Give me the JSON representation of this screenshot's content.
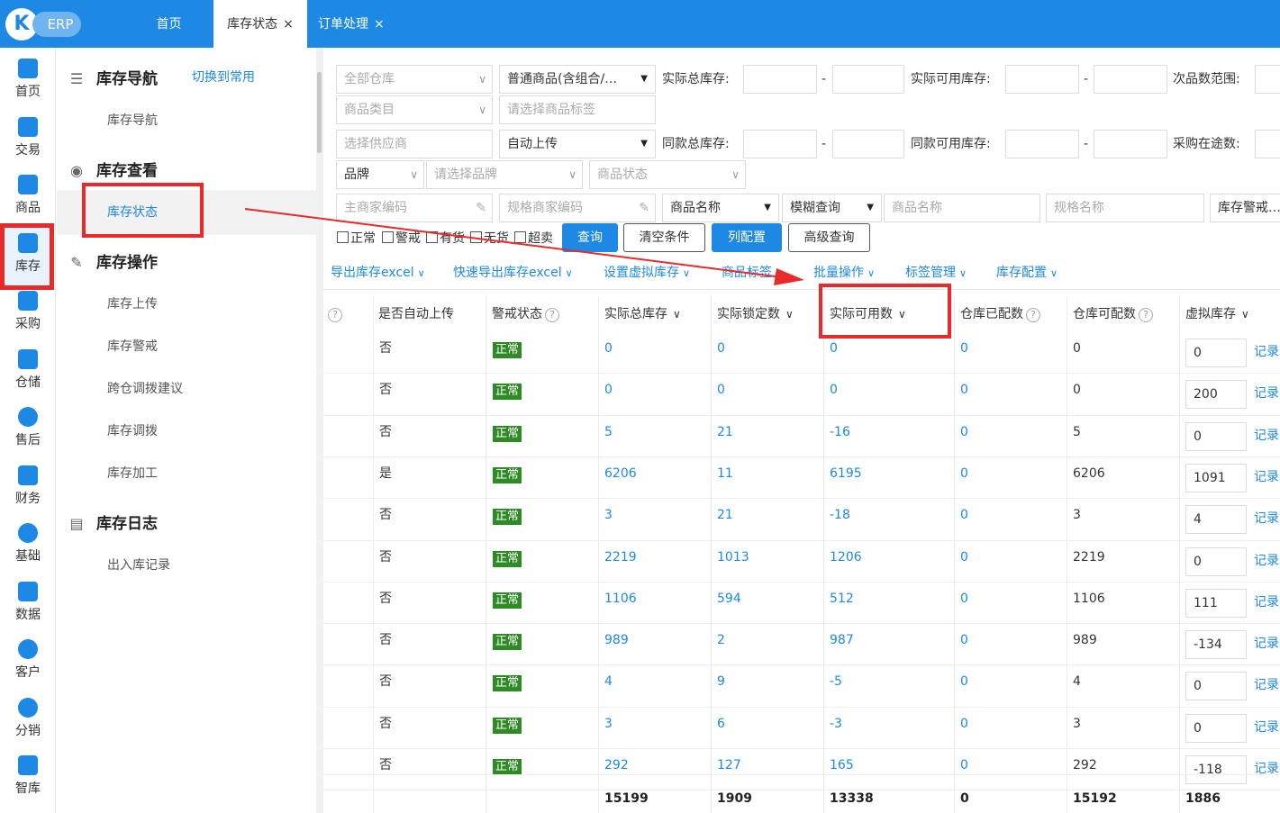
{
  "topbar": {
    "logo_letter": "K",
    "logo_text": "ERP",
    "tabs": [
      {
        "label": "首页",
        "closable": false,
        "active": false
      },
      {
        "label": "库存状态",
        "closable": true,
        "active": true
      },
      {
        "label": "订单处理",
        "closable": true,
        "active": false
      }
    ],
    "close_glyph": "×"
  },
  "leftnav": {
    "items": [
      {
        "label": "首页",
        "icon": "home-icon"
      },
      {
        "label": "交易",
        "icon": "trade-icon"
      },
      {
        "label": "商品",
        "icon": "product-icon"
      },
      {
        "label": "库存",
        "icon": "inventory-icon"
      },
      {
        "label": "采购",
        "icon": "purchase-icon"
      },
      {
        "label": "仓储",
        "icon": "warehouse-icon"
      },
      {
        "label": "售后",
        "icon": "aftersale-icon"
      },
      {
        "label": "财务",
        "icon": "finance-icon"
      },
      {
        "label": "基础",
        "icon": "settings-icon"
      },
      {
        "label": "数据",
        "icon": "data-icon"
      },
      {
        "label": "客户",
        "icon": "customer-icon"
      },
      {
        "label": "分销",
        "icon": "distribution-icon"
      },
      {
        "label": "智库",
        "icon": "insight-icon"
      }
    ],
    "active_index": 3
  },
  "sidemenu": {
    "switch_label": "切换到常用",
    "sections": [
      {
        "title": "库存导航",
        "icon": "list-icon",
        "items": [
          "库存导航"
        ]
      },
      {
        "title": "库存查看",
        "icon": "eye-icon",
        "items": [
          "库存状态"
        ]
      },
      {
        "title": "库存操作",
        "icon": "wrench-icon",
        "items": [
          "库存上传",
          "库存警戒",
          "跨仓调拨建议",
          "库存调拨",
          "库存加工"
        ]
      },
      {
        "title": "库存日志",
        "icon": "clipboard-icon",
        "items": [
          "出入库记录"
        ]
      }
    ],
    "active_item": "库存状态"
  },
  "filters": {
    "warehouse": "全部仓库",
    "goods_type": "普通商品(含组合/…",
    "category": "商品类目",
    "tag_placeholder": "请选择商品标签",
    "supplier_placeholder": "选择供应商",
    "auto_upload": "自动上传",
    "brand": "品牌",
    "brand_placeholder": "请选择品牌",
    "goods_status": "商品状态",
    "main_code_placeholder": "主商家编码",
    "spec_code_placeholder": "规格商家编码",
    "name_field": "商品名称",
    "match_mode": "模糊查询",
    "name_placeholder": "商品名称",
    "spec_name_placeholder": "规格名称",
    "alert_select": "库存警戒…",
    "labels": {
      "actual_total": "实际总库存:",
      "actual_available": "实际可用库存:",
      "defect_range": "次品数范围:",
      "same_total": "同款总库存:",
      "same_available": "同款可用库存:",
      "purchase_transit": "采购在途数:"
    },
    "dash": "-",
    "checkboxes": [
      "正常",
      "警戒",
      "有货",
      "无货",
      "超卖"
    ]
  },
  "buttons": {
    "query": "查询",
    "clear": "清空条件",
    "columns": "列配置",
    "advanced": "高级查询"
  },
  "actions": [
    "导出库存excel",
    "快速导出库存excel",
    "设置虚拟库存",
    "商品标签",
    "批量操作",
    "标签管理",
    "库存配置"
  ],
  "table": {
    "headers": [
      "是否自动上传",
      "警戒状态",
      "实际总库存",
      "实际锁定数",
      "实际可用数",
      "仓库已配数",
      "仓库可配数",
      "虚拟库存"
    ],
    "record_label": "记录",
    "rows": [
      {
        "auto": "否",
        "alert": "正常",
        "total": "0",
        "locked": "0",
        "available": "0",
        "allocated": "0",
        "allocatable": "0",
        "virtual": "0"
      },
      {
        "auto": "否",
        "alert": "正常",
        "total": "0",
        "locked": "0",
        "available": "0",
        "allocated": "0",
        "allocatable": "0",
        "virtual": "200"
      },
      {
        "auto": "否",
        "alert": "正常",
        "total": "5",
        "locked": "21",
        "available": "-16",
        "allocated": "0",
        "allocatable": "5",
        "virtual": "0"
      },
      {
        "auto": "是",
        "alert": "正常",
        "total": "6206",
        "locked": "11",
        "available": "6195",
        "allocated": "0",
        "allocatable": "6206",
        "virtual": "1091"
      },
      {
        "auto": "否",
        "alert": "正常",
        "total": "3",
        "locked": "21",
        "available": "-18",
        "allocated": "0",
        "allocatable": "3",
        "virtual": "4"
      },
      {
        "auto": "否",
        "alert": "正常",
        "total": "2219",
        "locked": "1013",
        "available": "1206",
        "allocated": "0",
        "allocatable": "2219",
        "virtual": "0"
      },
      {
        "auto": "否",
        "alert": "正常",
        "total": "1106",
        "locked": "594",
        "available": "512",
        "allocated": "0",
        "allocatable": "1106",
        "virtual": "111"
      },
      {
        "auto": "否",
        "alert": "正常",
        "total": "989",
        "locked": "2",
        "available": "987",
        "allocated": "0",
        "allocatable": "989",
        "virtual": "-134"
      },
      {
        "auto": "否",
        "alert": "正常",
        "total": "4",
        "locked": "9",
        "available": "-5",
        "allocated": "0",
        "allocatable": "4",
        "virtual": "0"
      },
      {
        "auto": "否",
        "alert": "正常",
        "total": "3",
        "locked": "6",
        "available": "-3",
        "allocated": "0",
        "allocatable": "3",
        "virtual": "0"
      },
      {
        "auto": "否",
        "alert": "正常",
        "total": "292",
        "locked": "127",
        "available": "165",
        "allocated": "0",
        "allocatable": "292",
        "virtual": "-118"
      }
    ],
    "totals": {
      "total": "15199",
      "locked": "1909",
      "available": "13338",
      "allocated": "0",
      "allocatable": "15192",
      "virtual": "1886"
    }
  },
  "colors": {
    "primary": "#1e88e5",
    "highlight": "#e82a2a",
    "badge": "#2d8a24"
  }
}
